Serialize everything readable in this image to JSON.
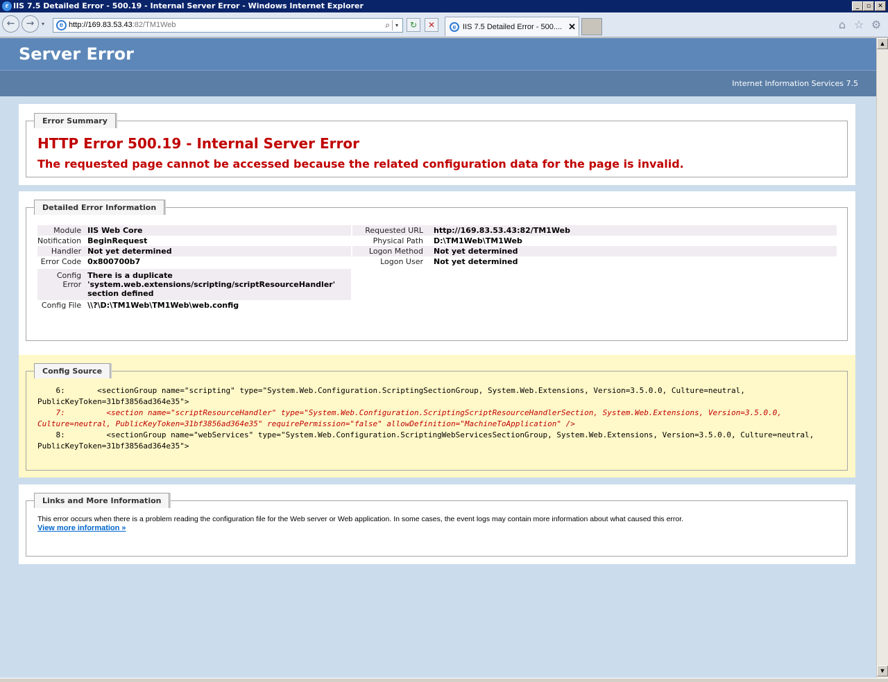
{
  "window": {
    "title": "IIS 7.5 Detailed Error - 500.19 - Internal Server Error - Windows Internet Explorer",
    "app_icon": "e",
    "minimize": "_",
    "maximize": "▫",
    "close": "✕"
  },
  "toolbar": {
    "back_icon": "←",
    "forward_icon": "→",
    "address_host": "http://169.83.53.43",
    "address_rest": ":82/TM1Web",
    "search_icon": "⌕",
    "dropdown": "▾",
    "refresh_icon": "↻",
    "stop_icon": "✕",
    "tab_label": "IIS 7.5 Detailed Error - 500....",
    "tab_close": "✕",
    "home_icon": "⌂",
    "favorites_icon": "☆",
    "tools_icon": "⚙"
  },
  "page": {
    "title": "Server Error",
    "subtitle": "Internet Information Services 7.5",
    "summary": {
      "legend": "Error Summary",
      "heading": "HTTP Error 500.19 - Internal Server Error",
      "message": "The requested page cannot be accessed because the related configuration data for the page is invalid."
    },
    "details": {
      "legend": "Detailed Error Information",
      "left": [
        {
          "key": "Module",
          "value": "IIS Web Core"
        },
        {
          "key": "Notification",
          "value": "BeginRequest"
        },
        {
          "key": "Handler",
          "value": "Not yet determined"
        },
        {
          "key": "Error Code",
          "value": "0x800700b7"
        },
        {
          "key": "Config Error",
          "value": "There is a duplicate 'system.web.extensions/scripting/scriptResourceHandler' section defined"
        },
        {
          "key": "Config File",
          "value": "\\\\?\\D:\\TM1Web\\TM1Web\\web.config"
        }
      ],
      "right": [
        {
          "key": "Requested URL",
          "value": "http://169.83.53.43:82/TM1Web"
        },
        {
          "key": "Physical Path",
          "value": "D:\\TM1Web\\TM1Web"
        },
        {
          "key": "Logon Method",
          "value": "Not yet determined"
        },
        {
          "key": "Logon User",
          "value": "Not yet determined"
        }
      ]
    },
    "config_source": {
      "legend": "Config Source",
      "line6": "    6:       <sectionGroup name=\"scripting\" type=\"System.Web.Configuration.ScriptingSectionGroup, System.Web.Extensions, Version=3.5.0.0, Culture=neutral, PublicKeyToken=31bf3856ad364e35\">",
      "line7": "    7:         <section name=\"scriptResourceHandler\" type=\"System.Web.Configuration.ScriptingScriptResourceHandlerSection, System.Web.Extensions, Version=3.5.0.0, Culture=neutral, PublicKeyToken=31bf3856ad364e35\" requirePermission=\"false\" allowDefinition=\"MachineToApplication\" />",
      "line8": "    8:         <sectionGroup name=\"webServices\" type=\"System.Web.Configuration.ScriptingWebServicesSectionGroup, System.Web.Extensions, Version=3.5.0.0, Culture=neutral, PublicKeyToken=31bf3856ad364e35\">"
    },
    "links": {
      "legend": "Links and More Information",
      "text": "This error occurs when there is a problem reading the configuration file for the Web server or Web application. In some cases, the event logs may contain more information about what caused this error.",
      "link": "View more information »"
    }
  },
  "scrollbar": {
    "up": "▲",
    "down": "▼"
  },
  "colors": {
    "header": "#5c87b8",
    "error_red": "#c00000",
    "config_bg": "#fff8c8",
    "page_bg": "#cbdcec",
    "link": "#0066cc"
  }
}
